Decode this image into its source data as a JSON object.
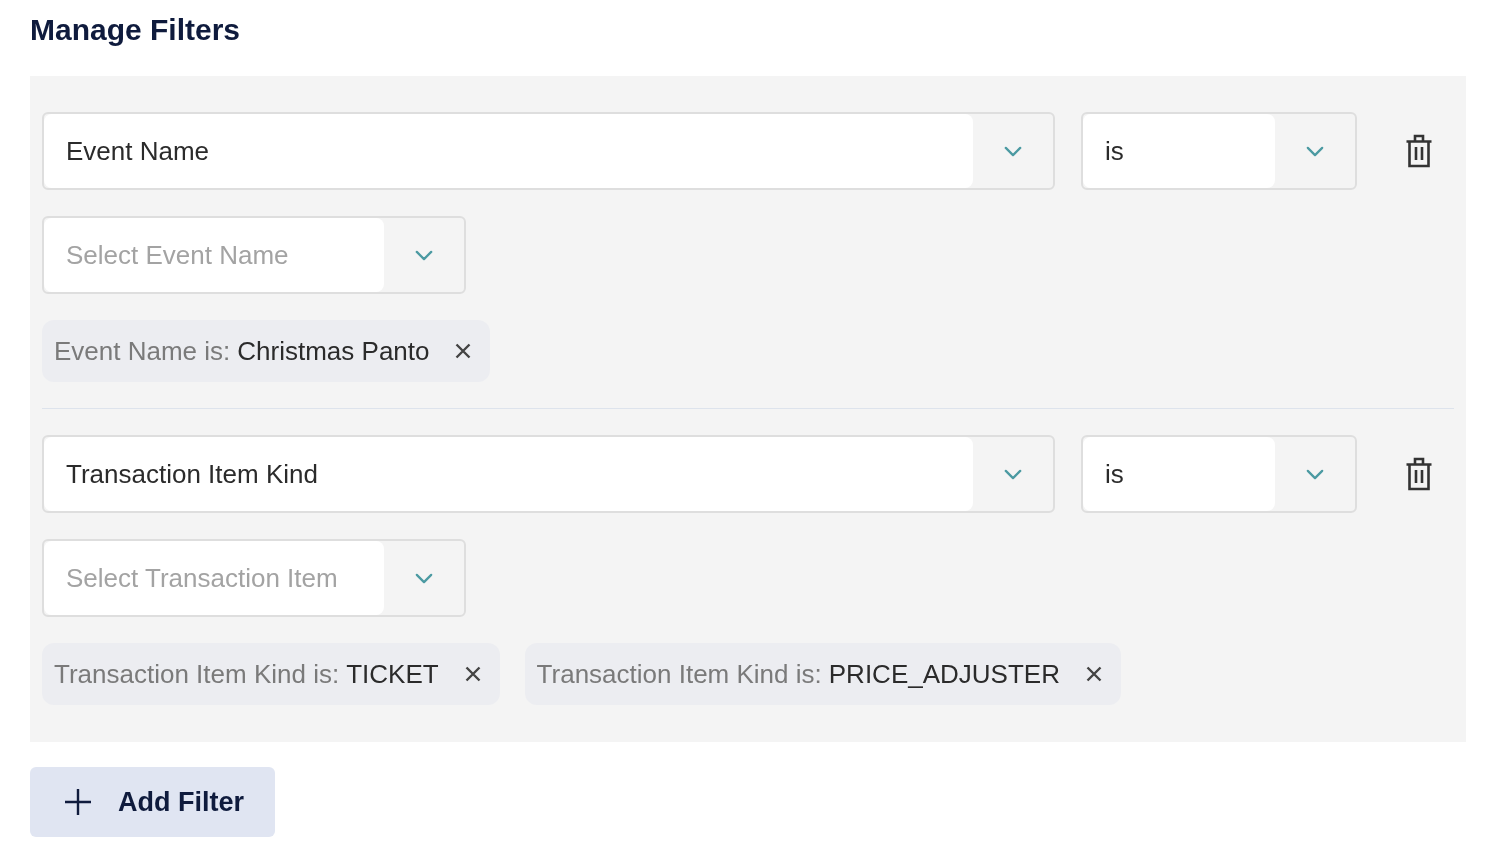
{
  "title": "Manage Filters",
  "filters": [
    {
      "field": "Event Name",
      "operator": "is",
      "value_input": {
        "placeholder": "Select Event Name"
      },
      "chips": [
        {
          "label": "Event Name is:",
          "value": "Christmas Panto"
        }
      ]
    },
    {
      "field": "Transaction Item Kind",
      "operator": "is",
      "value_input": {
        "placeholder": "Select Transaction Item"
      },
      "chips": [
        {
          "label": "Transaction Item Kind is:",
          "value": "TICKET"
        },
        {
          "label": "Transaction Item Kind is:",
          "value": "PRICE_ADJUSTER"
        }
      ]
    }
  ],
  "add_button": {
    "label": "Add Filter"
  }
}
